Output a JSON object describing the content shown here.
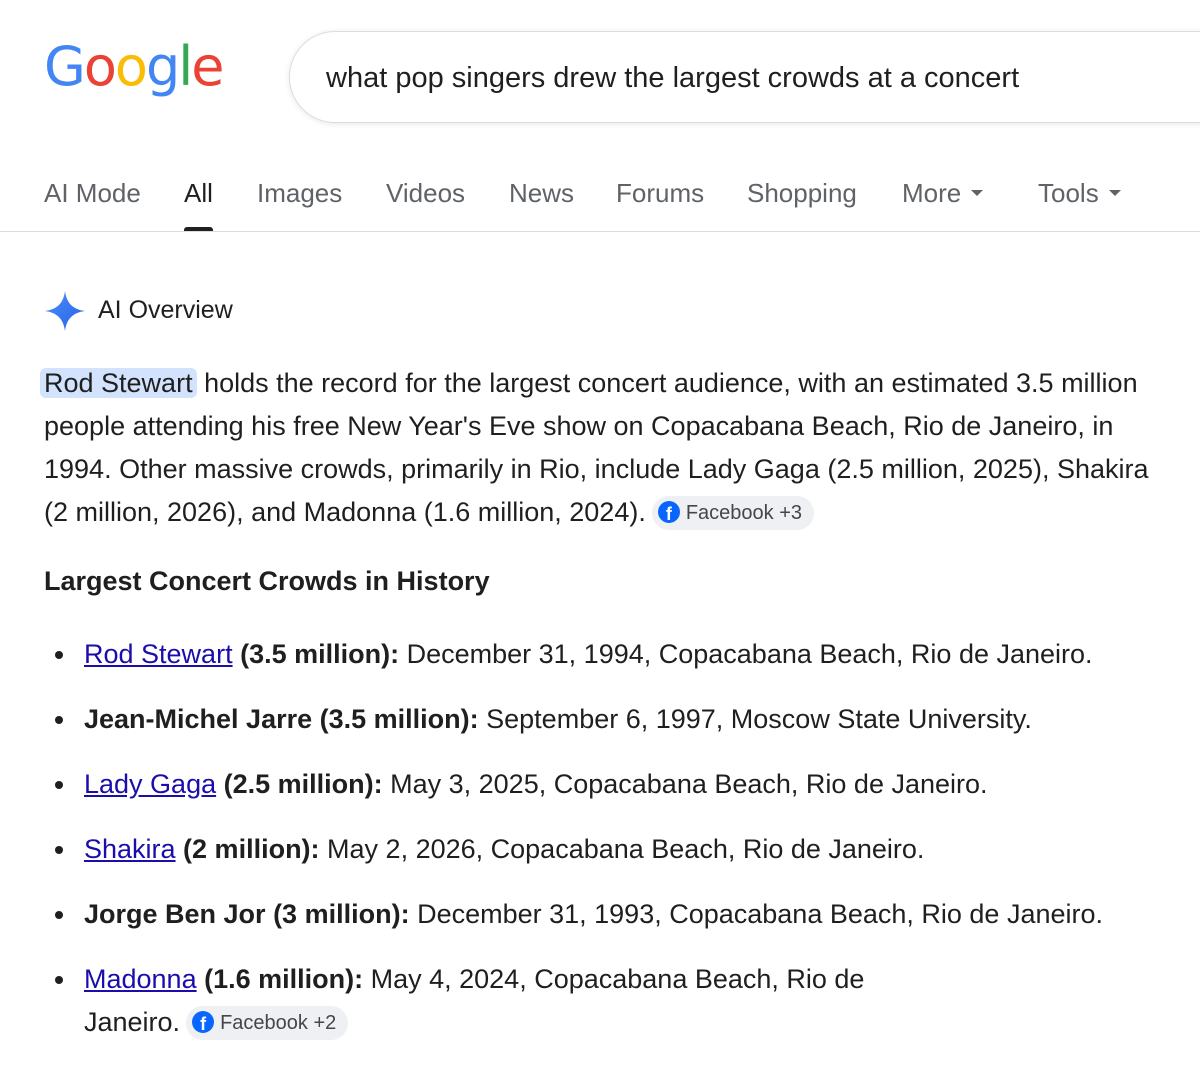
{
  "logo": {
    "letters": [
      "G",
      "o",
      "o",
      "g",
      "l",
      "e"
    ],
    "colors": [
      "#4285F4",
      "#EA4335",
      "#FBBC05",
      "#4285F4",
      "#34A853",
      "#EA4335"
    ]
  },
  "search": {
    "query": "what pop singers drew the largest crowds at a concert"
  },
  "tabs": [
    {
      "label": "AI Mode"
    },
    {
      "label": "All",
      "active": true
    },
    {
      "label": "Images"
    },
    {
      "label": "Videos"
    },
    {
      "label": "News"
    },
    {
      "label": "Forums"
    },
    {
      "label": "Shopping"
    },
    {
      "label": "More"
    },
    {
      "label": "Tools"
    }
  ],
  "ai_overview": {
    "title": "AI Overview",
    "summary": {
      "highlight": "Rod Stewart",
      "text": " holds the record for the largest concert audience, with an estimated 3.5 million people attending his free New Year's Eve show on Copacabana Beach, Rio de Janeiro, in 1994. Other massive crowds, primarily in Rio, include Lady Gaga (2.5 million, 2025), Shakira (2 million, 2026), and Madonna (1.6 million, 2024).",
      "source_chip": "Facebook +3"
    },
    "section_title": "Largest Concert Crowds in History",
    "items": [
      {
        "name": "Rod Stewart",
        "linked": true,
        "count": " (3.5 million):",
        "details": " December 31, 1994, Copacabana Beach, Rio de Janeiro."
      },
      {
        "name": "Jean-Michel Jarre",
        "linked": false,
        "count": " (3.5 million):",
        "details": " September 6, 1997, Moscow State University."
      },
      {
        "name": "Lady Gaga",
        "linked": true,
        "count": " (2.5 million):",
        "details": " May 3, 2025, Copacabana Beach, Rio de Janeiro."
      },
      {
        "name": "Shakira",
        "linked": true,
        "count": " (2 million):",
        "details": " May 2, 2026, Copacabana Beach, Rio de Janeiro."
      },
      {
        "name": "Jorge Ben Jor",
        "linked": false,
        "count": " (3 million):",
        "details": " December 31, 1993, Copacabana Beach, Rio de Janeiro."
      },
      {
        "name": "Madonna",
        "linked": true,
        "count": " (1.6 million):",
        "details": " May 4, 2024, Copacabana Beach, Rio de Janeiro.",
        "source_chip": "Facebook +2"
      }
    ]
  },
  "icons": {
    "sparkle": "sparkle-icon",
    "facebook": "facebook-icon",
    "dropdown": "chevron-down-icon"
  },
  "colors": {
    "link": "#1a0dab",
    "highlight": "#d3e3fd",
    "facebook": "#0866ff",
    "sparkle": "#4285F4"
  }
}
